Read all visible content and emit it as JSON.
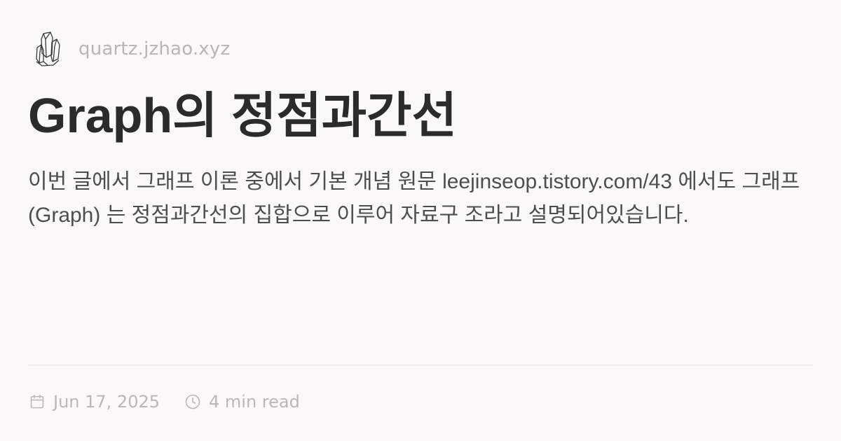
{
  "site": {
    "name": "quartz.jzhao.xyz",
    "logo_icon": "quartz-crystal-logo-icon"
  },
  "article": {
    "title": "Graph의 정점과간선",
    "description": "이번 글에서 그래프 이론 중에서 기본 개념 원문 leejinseop.tistory.com/43 에서도 그래프(Graph) 는 정점과간선의 집합으로 이루어 자료구 조라고 설명되어있습니다."
  },
  "meta": {
    "date": "Jun 17, 2025",
    "date_icon": "calendar-icon",
    "reading_time": "4 min read",
    "reading_time_icon": "clock-icon"
  },
  "colors": {
    "background": "#faf8f8",
    "title": "#2b2b2b",
    "body_text": "#4e4e4e",
    "muted": "#b9b7b8",
    "divider": "#e6e4e4"
  }
}
